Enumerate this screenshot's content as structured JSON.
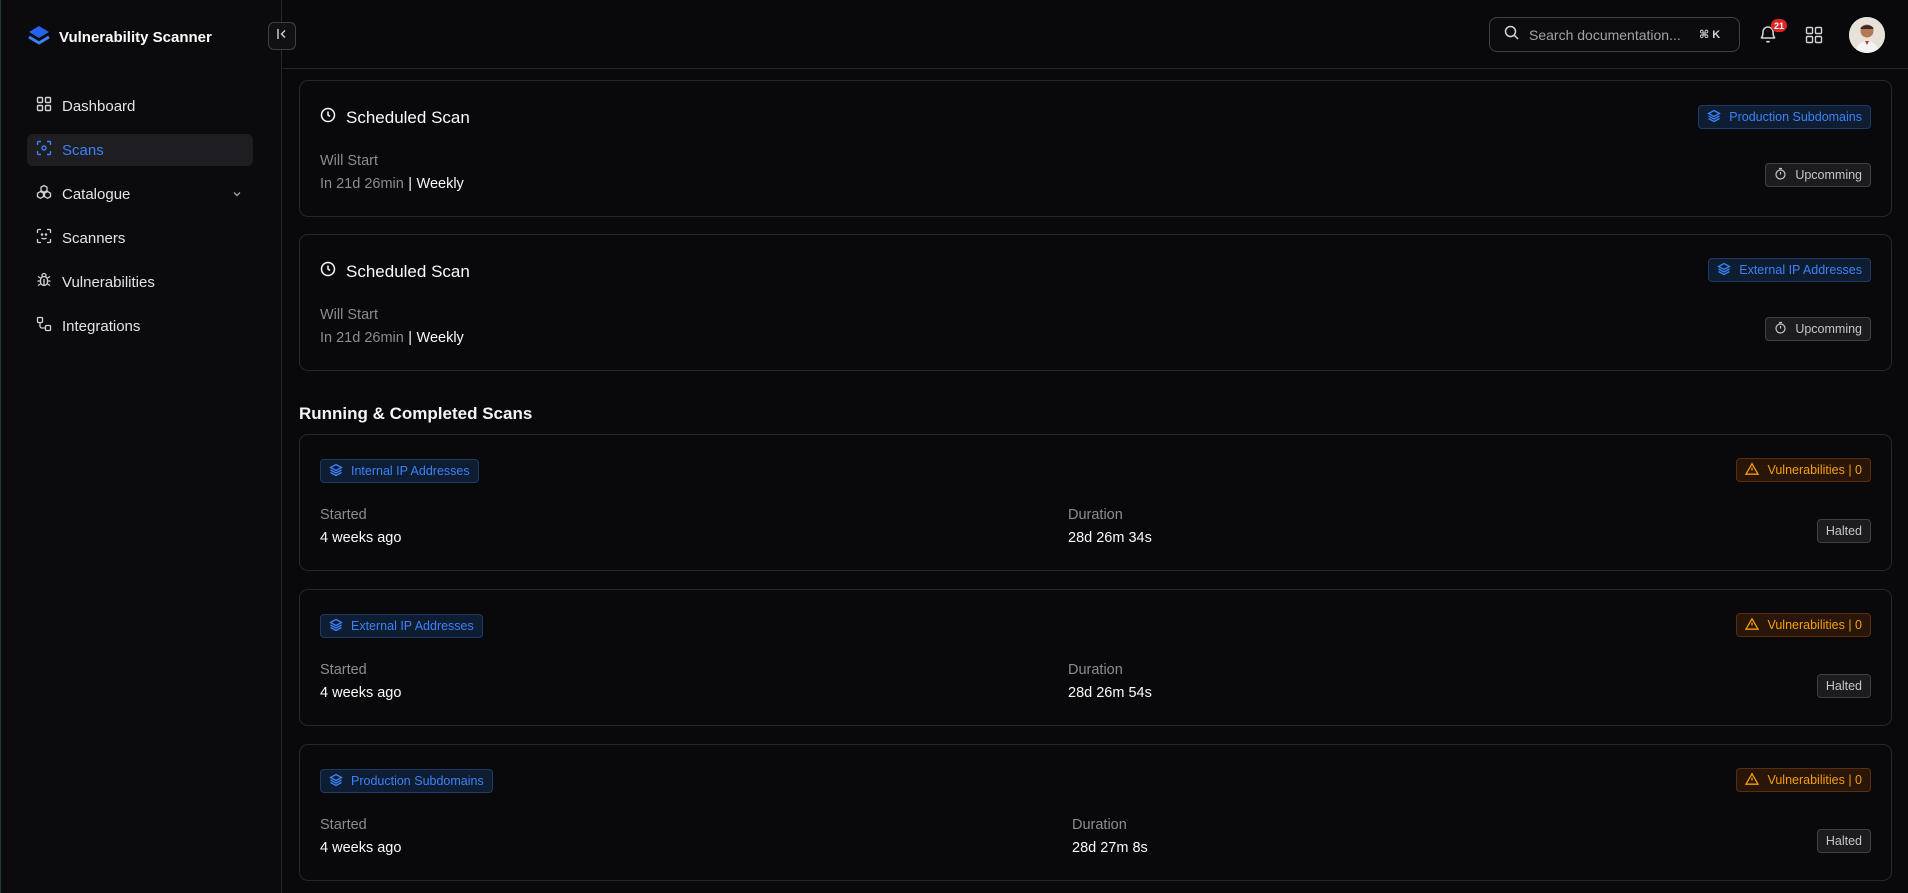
{
  "app": {
    "title": "Vulnerability Scanner"
  },
  "sidebar": {
    "items": [
      {
        "label": "Dashboard",
        "icon": "grid-icon"
      },
      {
        "label": "Scans",
        "icon": "scan-icon",
        "active": true
      },
      {
        "label": "Catalogue",
        "icon": "boxes-icon",
        "expandable": true
      },
      {
        "label": "Scanners",
        "icon": "scan-face-icon"
      },
      {
        "label": "Vulnerabilities",
        "icon": "bug-icon"
      },
      {
        "label": "Integrations",
        "icon": "workflow-icon"
      }
    ]
  },
  "header": {
    "search_placeholder": "Search documentation...",
    "shortcut": "⌘ K",
    "notifications_count": "21"
  },
  "scheduled": [
    {
      "title": "Scheduled Scan",
      "target": "Production Subdomains",
      "start_label": "Will Start",
      "start_in": "In 21d 26min",
      "separator": "|",
      "frequency": "Weekly",
      "status": "Upcomming"
    },
    {
      "title": "Scheduled Scan",
      "target": "External IP Addresses",
      "start_label": "Will Start",
      "start_in": "In 21d 26min",
      "separator": "|",
      "frequency": "Weekly",
      "status": "Upcomming"
    }
  ],
  "running_title": "Running & Completed Scans",
  "scans": [
    {
      "target": "Internal IP Addresses",
      "vulns": "Vulnerabilities | 0",
      "started_label": "Started",
      "started": "4 weeks ago",
      "duration_label": "Duration",
      "duration": "28d 26m 34s",
      "status": "Halted"
    },
    {
      "target": "External IP Addresses",
      "vulns": "Vulnerabilities | 0",
      "started_label": "Started",
      "started": "4 weeks ago",
      "duration_label": "Duration",
      "duration": "28d 26m 54s",
      "status": "Halted"
    },
    {
      "target": "Production Subdomains",
      "vulns": "Vulnerabilities | 0",
      "started_label": "Started",
      "started": "4 weeks ago",
      "duration_label": "Duration",
      "duration": "28d 27m 8s",
      "status": "Halted"
    }
  ],
  "colors": {
    "accent": "#3b82f6",
    "warning": "#f59e0b",
    "badge": "#dc2626",
    "background": "#09090b"
  }
}
